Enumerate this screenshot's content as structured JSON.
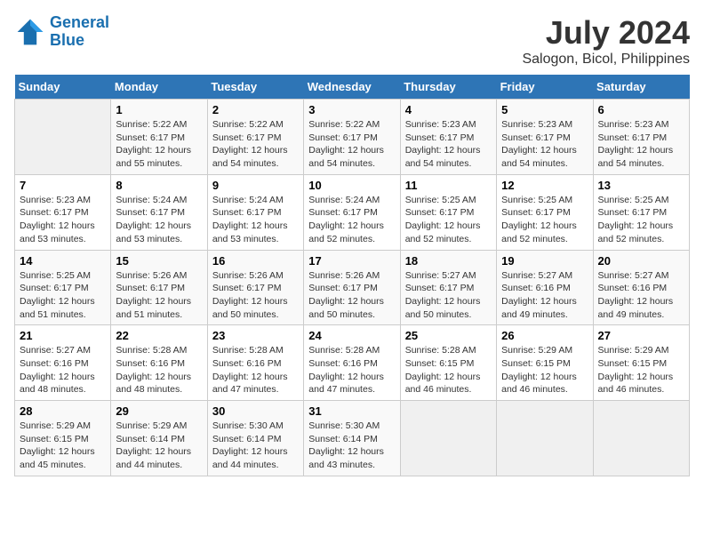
{
  "header": {
    "logo_line1": "General",
    "logo_line2": "Blue",
    "month": "July 2024",
    "location": "Salogon, Bicol, Philippines"
  },
  "weekdays": [
    "Sunday",
    "Monday",
    "Tuesday",
    "Wednesday",
    "Thursday",
    "Friday",
    "Saturday"
  ],
  "weeks": [
    [
      {
        "day": "",
        "info": ""
      },
      {
        "day": "1",
        "info": "Sunrise: 5:22 AM\nSunset: 6:17 PM\nDaylight: 12 hours\nand 55 minutes."
      },
      {
        "day": "2",
        "info": "Sunrise: 5:22 AM\nSunset: 6:17 PM\nDaylight: 12 hours\nand 54 minutes."
      },
      {
        "day": "3",
        "info": "Sunrise: 5:22 AM\nSunset: 6:17 PM\nDaylight: 12 hours\nand 54 minutes."
      },
      {
        "day": "4",
        "info": "Sunrise: 5:23 AM\nSunset: 6:17 PM\nDaylight: 12 hours\nand 54 minutes."
      },
      {
        "day": "5",
        "info": "Sunrise: 5:23 AM\nSunset: 6:17 PM\nDaylight: 12 hours\nand 54 minutes."
      },
      {
        "day": "6",
        "info": "Sunrise: 5:23 AM\nSunset: 6:17 PM\nDaylight: 12 hours\nand 54 minutes."
      }
    ],
    [
      {
        "day": "7",
        "info": "Sunrise: 5:23 AM\nSunset: 6:17 PM\nDaylight: 12 hours\nand 53 minutes."
      },
      {
        "day": "8",
        "info": "Sunrise: 5:24 AM\nSunset: 6:17 PM\nDaylight: 12 hours\nand 53 minutes."
      },
      {
        "day": "9",
        "info": "Sunrise: 5:24 AM\nSunset: 6:17 PM\nDaylight: 12 hours\nand 53 minutes."
      },
      {
        "day": "10",
        "info": "Sunrise: 5:24 AM\nSunset: 6:17 PM\nDaylight: 12 hours\nand 52 minutes."
      },
      {
        "day": "11",
        "info": "Sunrise: 5:25 AM\nSunset: 6:17 PM\nDaylight: 12 hours\nand 52 minutes."
      },
      {
        "day": "12",
        "info": "Sunrise: 5:25 AM\nSunset: 6:17 PM\nDaylight: 12 hours\nand 52 minutes."
      },
      {
        "day": "13",
        "info": "Sunrise: 5:25 AM\nSunset: 6:17 PM\nDaylight: 12 hours\nand 52 minutes."
      }
    ],
    [
      {
        "day": "14",
        "info": "Sunrise: 5:25 AM\nSunset: 6:17 PM\nDaylight: 12 hours\nand 51 minutes."
      },
      {
        "day": "15",
        "info": "Sunrise: 5:26 AM\nSunset: 6:17 PM\nDaylight: 12 hours\nand 51 minutes."
      },
      {
        "day": "16",
        "info": "Sunrise: 5:26 AM\nSunset: 6:17 PM\nDaylight: 12 hours\nand 50 minutes."
      },
      {
        "day": "17",
        "info": "Sunrise: 5:26 AM\nSunset: 6:17 PM\nDaylight: 12 hours\nand 50 minutes."
      },
      {
        "day": "18",
        "info": "Sunrise: 5:27 AM\nSunset: 6:17 PM\nDaylight: 12 hours\nand 50 minutes."
      },
      {
        "day": "19",
        "info": "Sunrise: 5:27 AM\nSunset: 6:16 PM\nDaylight: 12 hours\nand 49 minutes."
      },
      {
        "day": "20",
        "info": "Sunrise: 5:27 AM\nSunset: 6:16 PM\nDaylight: 12 hours\nand 49 minutes."
      }
    ],
    [
      {
        "day": "21",
        "info": "Sunrise: 5:27 AM\nSunset: 6:16 PM\nDaylight: 12 hours\nand 48 minutes."
      },
      {
        "day": "22",
        "info": "Sunrise: 5:28 AM\nSunset: 6:16 PM\nDaylight: 12 hours\nand 48 minutes."
      },
      {
        "day": "23",
        "info": "Sunrise: 5:28 AM\nSunset: 6:16 PM\nDaylight: 12 hours\nand 47 minutes."
      },
      {
        "day": "24",
        "info": "Sunrise: 5:28 AM\nSunset: 6:16 PM\nDaylight: 12 hours\nand 47 minutes."
      },
      {
        "day": "25",
        "info": "Sunrise: 5:28 AM\nSunset: 6:15 PM\nDaylight: 12 hours\nand 46 minutes."
      },
      {
        "day": "26",
        "info": "Sunrise: 5:29 AM\nSunset: 6:15 PM\nDaylight: 12 hours\nand 46 minutes."
      },
      {
        "day": "27",
        "info": "Sunrise: 5:29 AM\nSunset: 6:15 PM\nDaylight: 12 hours\nand 46 minutes."
      }
    ],
    [
      {
        "day": "28",
        "info": "Sunrise: 5:29 AM\nSunset: 6:15 PM\nDaylight: 12 hours\nand 45 minutes."
      },
      {
        "day": "29",
        "info": "Sunrise: 5:29 AM\nSunset: 6:14 PM\nDaylight: 12 hours\nand 44 minutes."
      },
      {
        "day": "30",
        "info": "Sunrise: 5:30 AM\nSunset: 6:14 PM\nDaylight: 12 hours\nand 44 minutes."
      },
      {
        "day": "31",
        "info": "Sunrise: 5:30 AM\nSunset: 6:14 PM\nDaylight: 12 hours\nand 43 minutes."
      },
      {
        "day": "",
        "info": ""
      },
      {
        "day": "",
        "info": ""
      },
      {
        "day": "",
        "info": ""
      }
    ]
  ]
}
